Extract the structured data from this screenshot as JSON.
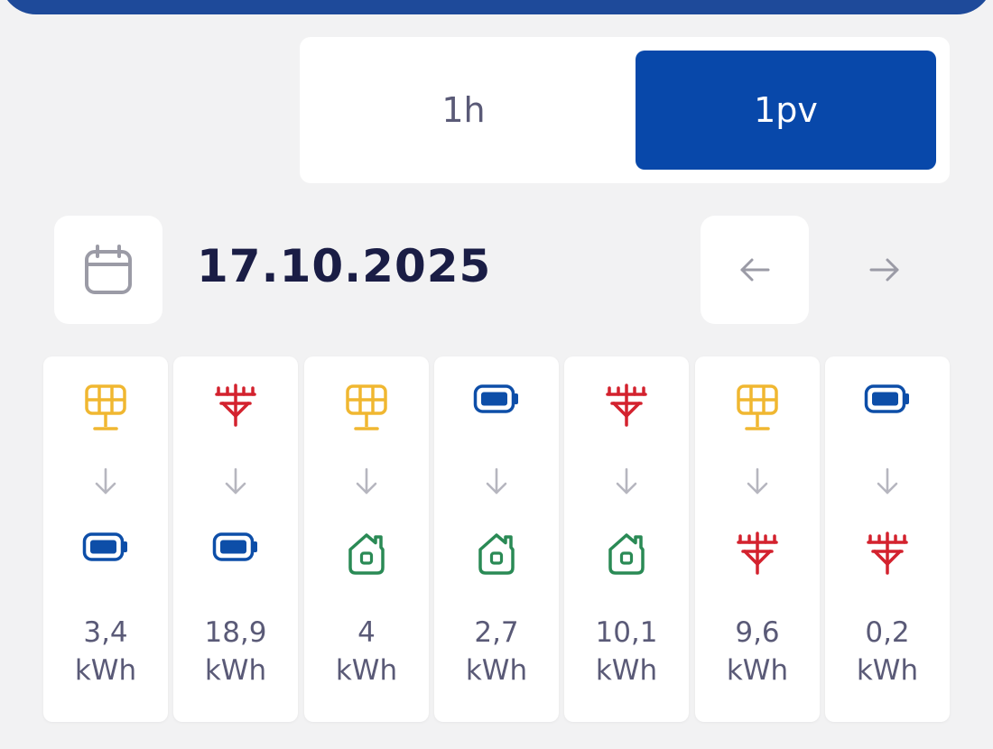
{
  "segment": {
    "option_1h": "1h",
    "option_1pv": "1pv",
    "selected": "1pv"
  },
  "date": {
    "value": "17.10.2025"
  },
  "flows": [
    {
      "from": "solar-panel-icon",
      "to": "battery-icon",
      "value": "3,4",
      "unit": "kWh"
    },
    {
      "from": "power-grid-icon",
      "to": "battery-icon",
      "value": "18,9",
      "unit": "kWh"
    },
    {
      "from": "solar-panel-icon",
      "to": "home-icon",
      "value": "4",
      "unit": "kWh"
    },
    {
      "from": "battery-icon",
      "to": "home-icon",
      "value": "2,7",
      "unit": "kWh"
    },
    {
      "from": "power-grid-icon",
      "to": "home-icon",
      "value": "10,1",
      "unit": "kWh"
    },
    {
      "from": "solar-panel-icon",
      "to": "power-grid-icon",
      "value": "9,6",
      "unit": "kWh"
    },
    {
      "from": "battery-icon",
      "to": "power-grid-icon",
      "value": "0,2",
      "unit": "kWh"
    }
  ],
  "colors": {
    "accent": "#0848aa",
    "solar": "#f0b731",
    "grid": "#d3222e",
    "battery": "#0d4ea8",
    "home": "#2a8a55",
    "text": "#5a5a77",
    "date_text": "#1a1d45"
  }
}
